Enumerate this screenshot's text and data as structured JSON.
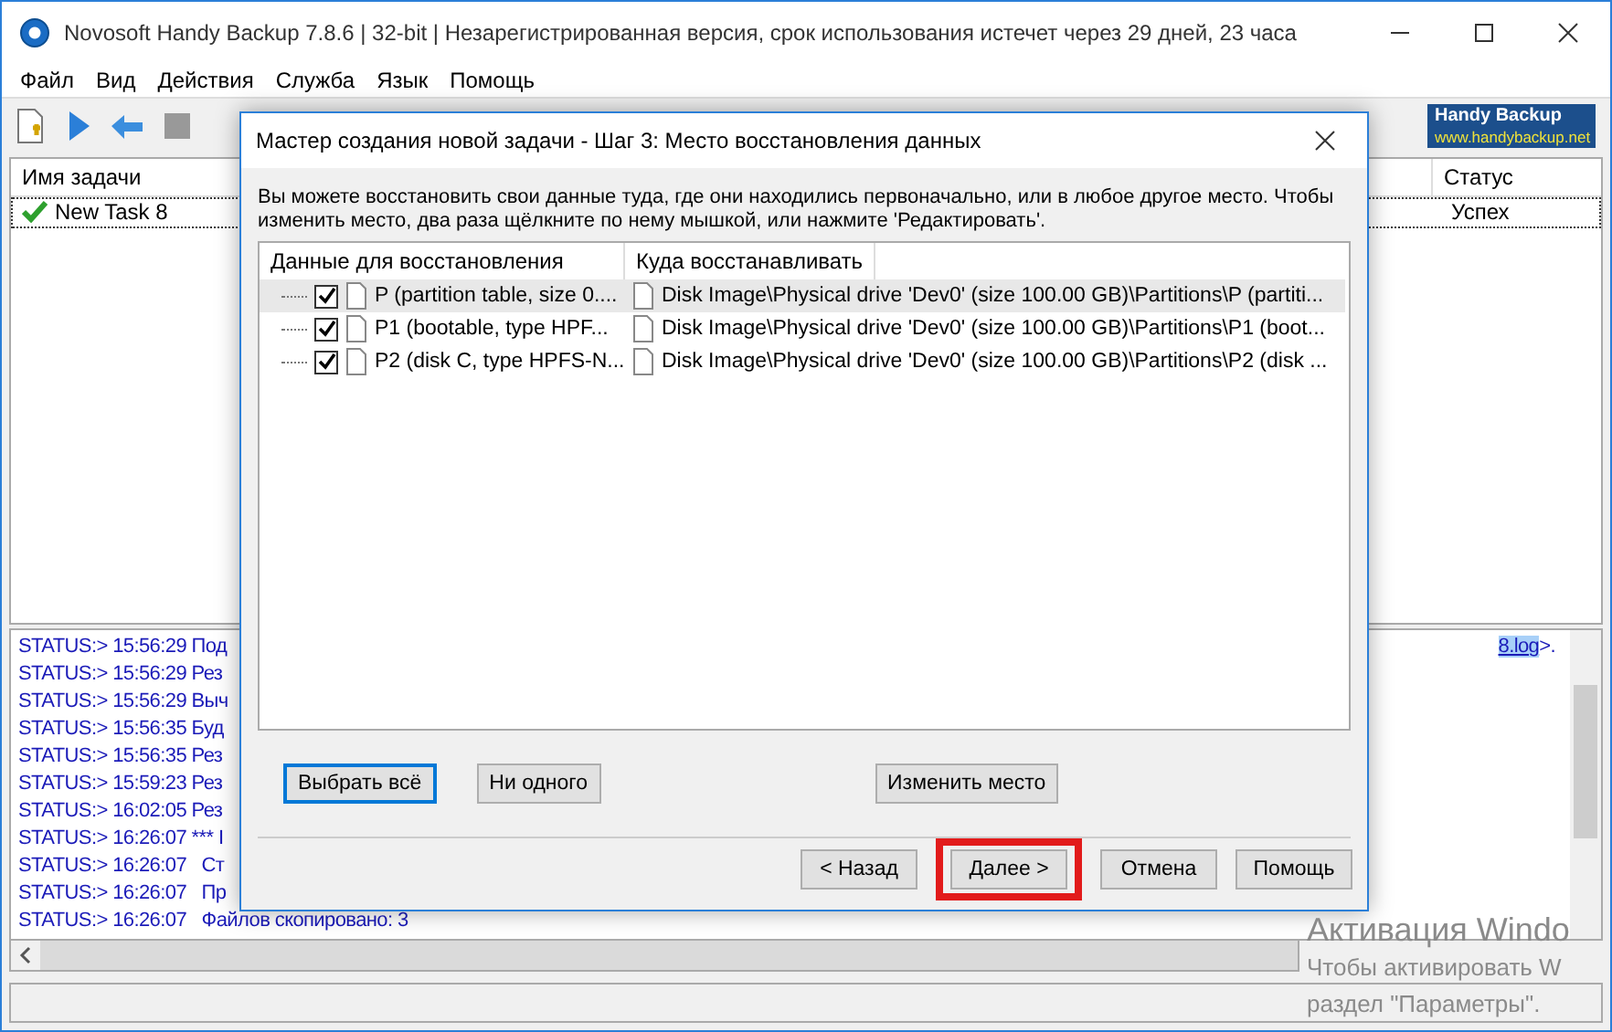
{
  "window": {
    "title": "Novosoft Handy Backup 7.8.6 | 32-bit | Незарегистрированная версия, срок использования истечет через  29 дней, 23 часа"
  },
  "menu": [
    "Файл",
    "Вид",
    "Действия",
    "Служба",
    "Язык",
    "Помощь"
  ],
  "logo": {
    "name": "Handy Backup",
    "url": "www.handybackup.net"
  },
  "task_list": {
    "columns": [
      "Имя задачи",
      "Статус"
    ],
    "rows": [
      {
        "name": "New Task 8",
        "status": "Успех",
        "selected": true
      }
    ]
  },
  "log": {
    "lines": [
      "STATUS:> 15:56:29 Под",
      "STATUS:> 15:56:29 Рез",
      "STATUS:> 15:56:29 Выч",
      "STATUS:> 15:56:35 Буд",
      "STATUS:> 15:56:35 Рез",
      "STATUS:> 15:59:23 Рез",
      "STATUS:> 16:02:05 Рез",
      "STATUS:> 16:26:07 *** I",
      "STATUS:> 16:26:07   Ст",
      "STATUS:> 16:26:07   Пр",
      "STATUS:> 16:26:07   Файлов скопировано: 3"
    ],
    "tail_link": "8.log",
    "tail_text": ">."
  },
  "dialog": {
    "title": "Мастер создания новой задачи - Шаг 3: Место восстановления данных",
    "description": "Вы можете восстановить свои данные туда, где они находились первоначально, или в любое другое место. Чтобы изменить место, два раза щёлкните по нему мышкой, или нажмите 'Редактировать'.",
    "tree": {
      "columns": [
        "Данные для восстановления",
        "Куда восстанавливать"
      ],
      "rows": [
        {
          "source": "P (partition table, size 0....",
          "target": "Disk Image\\Physical drive 'Dev0' (size 100.00 GB)\\Partitions\\P (partiti...",
          "checked": true,
          "selected": true
        },
        {
          "source": "P1 (bootable, type HPF...",
          "target": "Disk Image\\Physical drive 'Dev0' (size 100.00 GB)\\Partitions\\P1 (boot...",
          "checked": true,
          "selected": false
        },
        {
          "source": "P2 (disk C, type HPFS-N...",
          "target": "Disk Image\\Physical drive 'Dev0' (size 100.00 GB)\\Partitions\\P2 (disk ...",
          "checked": true,
          "selected": false
        }
      ]
    },
    "list_buttons": [
      {
        "label": "Выбрать всё",
        "focused": true
      },
      {
        "label": "Ни одного",
        "focused": false
      },
      {
        "label": "Изменить место",
        "focused": false
      }
    ],
    "nav_buttons": [
      {
        "label": "< Назад",
        "highlighted": false
      },
      {
        "label": "Далее >",
        "highlighted": true
      },
      {
        "label": "Отмена",
        "highlighted": false
      },
      {
        "label": "Помощь",
        "highlighted": false
      }
    ]
  },
  "activation_notice": [
    "Активация Windo",
    "Чтобы активировать W",
    "раздел \"Параметры\"."
  ]
}
